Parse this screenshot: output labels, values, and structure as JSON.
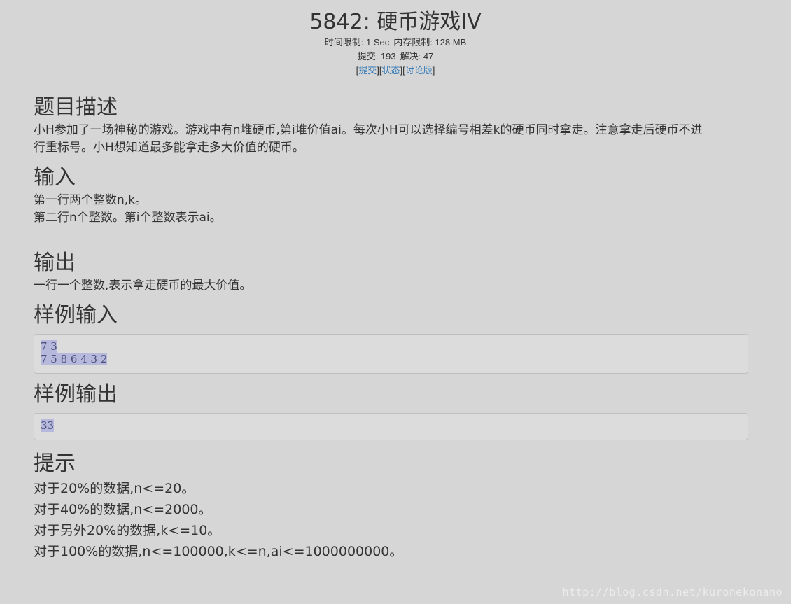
{
  "problem": {
    "title": "5842: 硬币游戏IV",
    "time_limit": "时间限制: 1 Sec",
    "memory_limit": "内存限制: 128 MB",
    "submissions": "提交: 193",
    "solved": "解决: 47",
    "links": {
      "submit": "提交",
      "status": "状态",
      "discuss": "讨论版"
    }
  },
  "sections": {
    "description": {
      "heading": "题目描述",
      "line1": "小H参加了一场神秘的游戏。游戏中有n堆硬币,第i堆价值ai。每次小H可以选择编号相差k的硬币同时拿走。注意拿走后硬币不进",
      "line2": "行重标号。小H想知道最多能拿走多大价值的硬币。"
    },
    "input": {
      "heading": "输入",
      "line1": "第一行两个整数n,k。",
      "line2": "第二行n个整数。第i个整数表示ai。"
    },
    "output": {
      "heading": "输出",
      "line1": "一行一个整数,表示拿走硬币的最大价值。"
    },
    "sample_input": {
      "heading": "样例输入",
      "line1": "7 3",
      "line2": "7 5 8 6 4 3 2"
    },
    "sample_output": {
      "heading": "样例输出",
      "line1": "33"
    },
    "hint": {
      "heading": "提示",
      "line1": "对于20%的数据,n<=20。",
      "line2": "对于40%的数据,n<=2000。",
      "line3": "对于另外20%的数据,k<=10。",
      "line4": "对于100%的数据,n<=100000,k<=n,ai<=1000000000。"
    }
  },
  "watermark": "http://blog.csdn.net/kuronekonano"
}
